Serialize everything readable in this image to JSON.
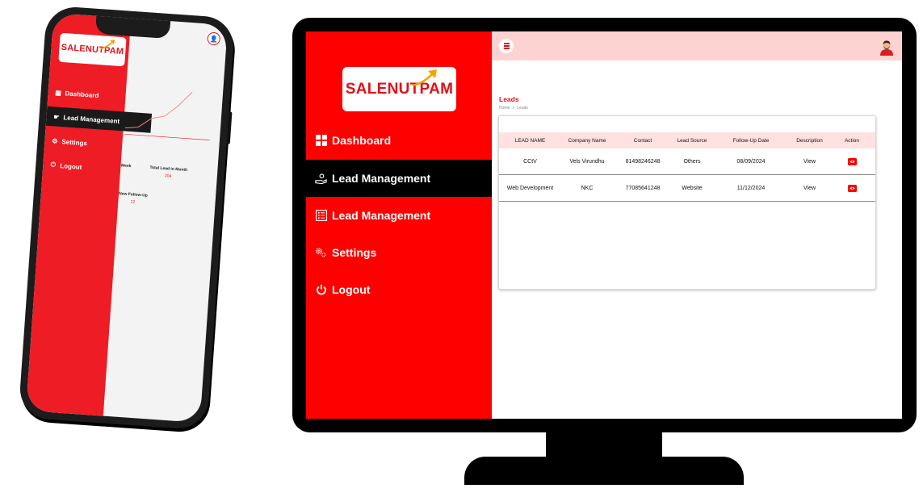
{
  "phone": {
    "logo_text": "SALENUTPAM",
    "nav": [
      {
        "label": "Dashboard",
        "icon": "grid-icon"
      },
      {
        "label": "Lead Management",
        "icon": "hand-lead-icon",
        "active": true
      },
      {
        "label": "Settings",
        "icon": "gear-icon"
      },
      {
        "label": "Logout",
        "icon": "power-icon"
      }
    ],
    "stats": {
      "week_label": "Week",
      "total_month_label": "Total Lead in Month",
      "total_month_value": "204",
      "followup_label": "New Follow-Up",
      "followup_value": "12"
    }
  },
  "desktop": {
    "logo_text": "SALENUTPAM",
    "nav": [
      {
        "label": "Dashboard",
        "icon": "grid-icon"
      },
      {
        "label": "Lead Management",
        "icon": "hand-lead-icon",
        "active": true
      },
      {
        "label": "Lead Management",
        "icon": "list-icon"
      },
      {
        "label": "Settings",
        "icon": "gear-icon"
      },
      {
        "label": "Logout",
        "icon": "power-icon"
      }
    ],
    "page_title": "Leads",
    "breadcrumb": {
      "home": "Home",
      "separator": ">",
      "current": "Leads"
    },
    "table": {
      "headers": [
        "LEAD NAME",
        "Company Name",
        "Contact",
        "Lead Source",
        "Follow-Up Date",
        "Description",
        "Action"
      ],
      "rows": [
        [
          "CCtV",
          "Vels Virundhu",
          "81498246248",
          "Others",
          "08/09/2024",
          "View"
        ],
        [
          "Web Development",
          "NKC",
          "77085641248",
          "Website",
          "11/12/2024",
          "View"
        ]
      ]
    }
  },
  "colors": {
    "brand_red": "#ff0000",
    "logo_red": "#e40f17",
    "topbar_pink": "#ffd2d2",
    "header_pink": "#ffe1e1",
    "active_nav": "#000000",
    "arrow_orange": "#f5a200"
  }
}
